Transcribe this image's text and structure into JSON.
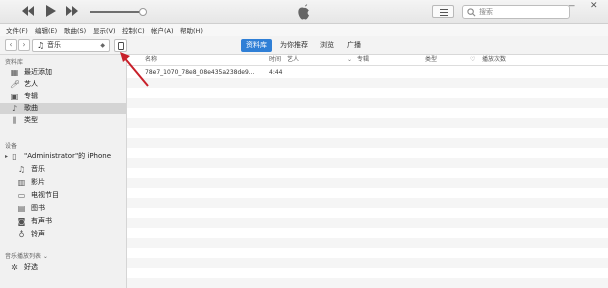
{
  "window": {
    "minimize": "—",
    "close": "✕"
  },
  "player": {
    "volume_level": 0.9,
    "search_placeholder": "搜索"
  },
  "menu": [
    "文件(F)",
    "编辑(E)",
    "歌曲(S)",
    "显示(V)",
    "控制(C)",
    "帐户(A)",
    "帮助(H)"
  ],
  "toolbar": {
    "media_select": "音乐",
    "tabs": [
      {
        "label": "资料库",
        "active": true
      },
      {
        "label": "为你推荐",
        "active": false
      },
      {
        "label": "浏览",
        "active": false
      },
      {
        "label": "广播",
        "active": false
      }
    ]
  },
  "sidebar": {
    "library_header": "资料库",
    "library": [
      {
        "label": "最近添加",
        "icon": "recently-added-icon"
      },
      {
        "label": "艺人",
        "icon": "artist-icon"
      },
      {
        "label": "专辑",
        "icon": "album-icon"
      },
      {
        "label": "歌曲",
        "icon": "song-icon",
        "active": true
      },
      {
        "label": "类型",
        "icon": "genre-icon"
      }
    ],
    "devices_header": "设备",
    "device_name": "\"Administrator\"的 iPhone",
    "device_items": [
      {
        "label": "音乐",
        "icon": "music-icon"
      },
      {
        "label": "影片",
        "icon": "movie-icon"
      },
      {
        "label": "电视节目",
        "icon": "tv-icon"
      },
      {
        "label": "图书",
        "icon": "book-icon"
      },
      {
        "label": "有声书",
        "icon": "audiobook-icon"
      },
      {
        "label": "铃声",
        "icon": "ringtone-icon"
      }
    ],
    "playlists_header": "音乐播放列表 ⌄",
    "playlists": [
      {
        "label": "好选",
        "icon": "genius-icon"
      }
    ]
  },
  "table": {
    "columns": [
      "名称",
      "时间",
      "艺人",
      "专辑",
      "类型",
      "播放次数"
    ],
    "rows": [
      {
        "name": "78e7_1070_78e8_08e435a238de9...",
        "time": "4:44",
        "artist": "",
        "album": "",
        "genre": "",
        "plays": ""
      }
    ]
  },
  "colors": {
    "accent": "#2f7fd6",
    "annotation_arrow": "#c8202a"
  }
}
